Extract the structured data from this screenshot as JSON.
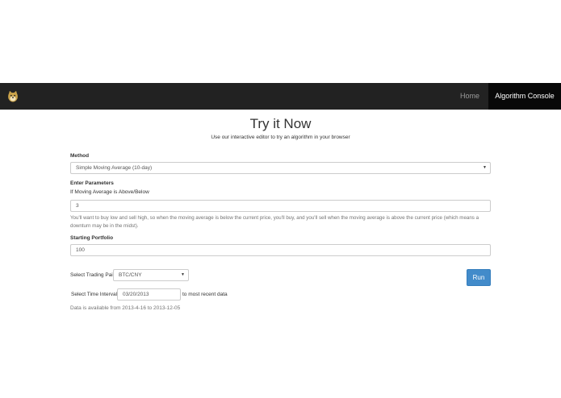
{
  "navbar": {
    "brand_icon": "doge-logo-icon",
    "home_label": "Home",
    "console_label": "Algorithm Console"
  },
  "page": {
    "title": "Try it Now",
    "subtitle": "Use our interactive editor to try an algorithm in your browser"
  },
  "form": {
    "method_label": "Method",
    "method_value": "Simple Moving Average (10-day)",
    "params_label": "Enter Parameters",
    "threshold_label": "If Moving Average is Above/Below",
    "threshold_value": "3",
    "help_text": "You'll want to buy low and sell high, so when the moving average is below the current price, you'll buy, and you'll sell when the moving average is above the current price (which means a downturn may be in the midst).",
    "portfolio_label": "Starting Portfolio",
    "portfolio_value": "100",
    "pair_label": "Select Trading Pair",
    "pair_value": "BTC/CNY",
    "interval_label": "Select Time Interval",
    "interval_value": "03/20/2013",
    "interval_suffix": "to most recent data",
    "availability_text": "Data is available from 2013-4-16 to 2013-12-05",
    "run_label": "Run"
  },
  "colors": {
    "navbar_bg": "#222222",
    "active_tab_bg": "#080808",
    "primary_button": "#428bca"
  }
}
